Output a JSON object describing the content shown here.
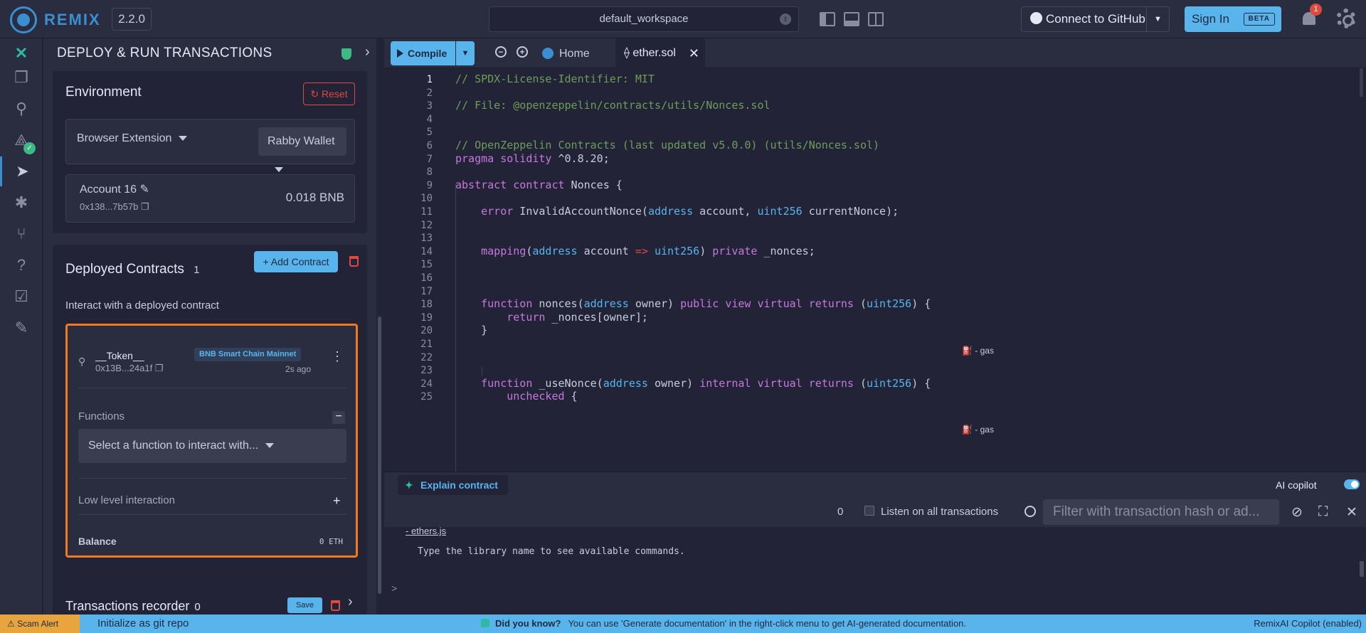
{
  "topbar": {
    "logo_text": "REMIX",
    "version": "2.2.0",
    "workspace": "default_workspace",
    "github_label": "Connect to GitHub",
    "signin_label": "Sign In",
    "beta_label": "BETA",
    "notification_count": "1"
  },
  "sidepanel": {
    "title": "DEPLOY & RUN TRANSACTIONS",
    "environment_title": "Environment",
    "reset_label": "Reset",
    "environment_value": "Browser Extension",
    "wallet_value": "Rabby Wallet",
    "account_name": "Account 16",
    "account_address": "0x138...7b57b",
    "account_balance": "0.018 BNB",
    "deployed_title": "Deployed Contracts",
    "deployed_count": "1",
    "add_contract_label": "+ Add Contract",
    "interact_hint": "Interact with a deployed contract",
    "contract": {
      "name": "__Token__",
      "address": "0x13B...24a1f",
      "network": "BNB Smart Chain Mainnet",
      "age": "2s ago",
      "functions_label": "Functions",
      "function_select": "Select a function to interact with...",
      "low_level_label": "Low level interaction",
      "balance_label": "Balance",
      "balance_value": "0 ETH"
    },
    "recorder_title": "Transactions recorder",
    "recorder_count": "0",
    "save_label": "Save"
  },
  "editor": {
    "compile_label": "Compile",
    "tab_home": "Home",
    "tab_file": "ether.sol",
    "gas_label": "- gas",
    "lines": [
      {
        "n": "1",
        "t": "// SPDX-License-Identifier: MIT"
      },
      {
        "n": "2",
        "t": ""
      },
      {
        "n": "3",
        "t": "// File: @openzeppelin/contracts/utils/Nonces.sol"
      },
      {
        "n": "4",
        "t": ""
      },
      {
        "n": "5",
        "t": ""
      },
      {
        "n": "6",
        "t": "// OpenZeppelin Contracts (last updated v5.0.0) (utils/Nonces.sol)"
      },
      {
        "n": "7",
        "t": "pragma solidity ^0.8.20;"
      },
      {
        "n": "8",
        "t": ""
      },
      {
        "n": "9",
        "t": "abstract contract Nonces {"
      },
      {
        "n": "10",
        "t": ""
      },
      {
        "n": "11",
        "t": "    error InvalidAccountNonce(address account, uint256 currentNonce);"
      },
      {
        "n": "12",
        "t": ""
      },
      {
        "n": "13",
        "t": ""
      },
      {
        "n": "14",
        "t": "    mapping(address account => uint256) private _nonces;"
      },
      {
        "n": "15",
        "t": ""
      },
      {
        "n": "16",
        "t": ""
      },
      {
        "n": "17",
        "t": ""
      },
      {
        "n": "18",
        "t": "    function nonces(address owner) public view virtual returns (uint256) {"
      },
      {
        "n": "19",
        "t": "        return _nonces[owner];"
      },
      {
        "n": "20",
        "t": "    }"
      },
      {
        "n": "21",
        "t": ""
      },
      {
        "n": "22",
        "t": ""
      },
      {
        "n": "23",
        "t": ""
      },
      {
        "n": "24",
        "t": "    function _useNonce(address owner) internal virtual returns (uint256) {"
      },
      {
        "n": "25",
        "t": "        unchecked {"
      }
    ]
  },
  "terminal": {
    "explain_label": "Explain contract",
    "copilot_label": "AI copilot",
    "tx_count": "0",
    "listen_label": "Listen on all transactions",
    "filter_placeholder": "Filter with transaction hash or ad...",
    "line_partial": "- ethers.js",
    "line_hint": "Type the library name to see available commands.",
    "prompt": ">"
  },
  "statusbar": {
    "scam_label": "Scam Alert",
    "git_label": "Initialize as git repo",
    "dyk_title": "Did you know?",
    "dyk_text": "You can use 'Generate documentation' in the right-click menu to get AI-generated documentation.",
    "copilot_status": "RemixAI Copilot (enabled)"
  }
}
